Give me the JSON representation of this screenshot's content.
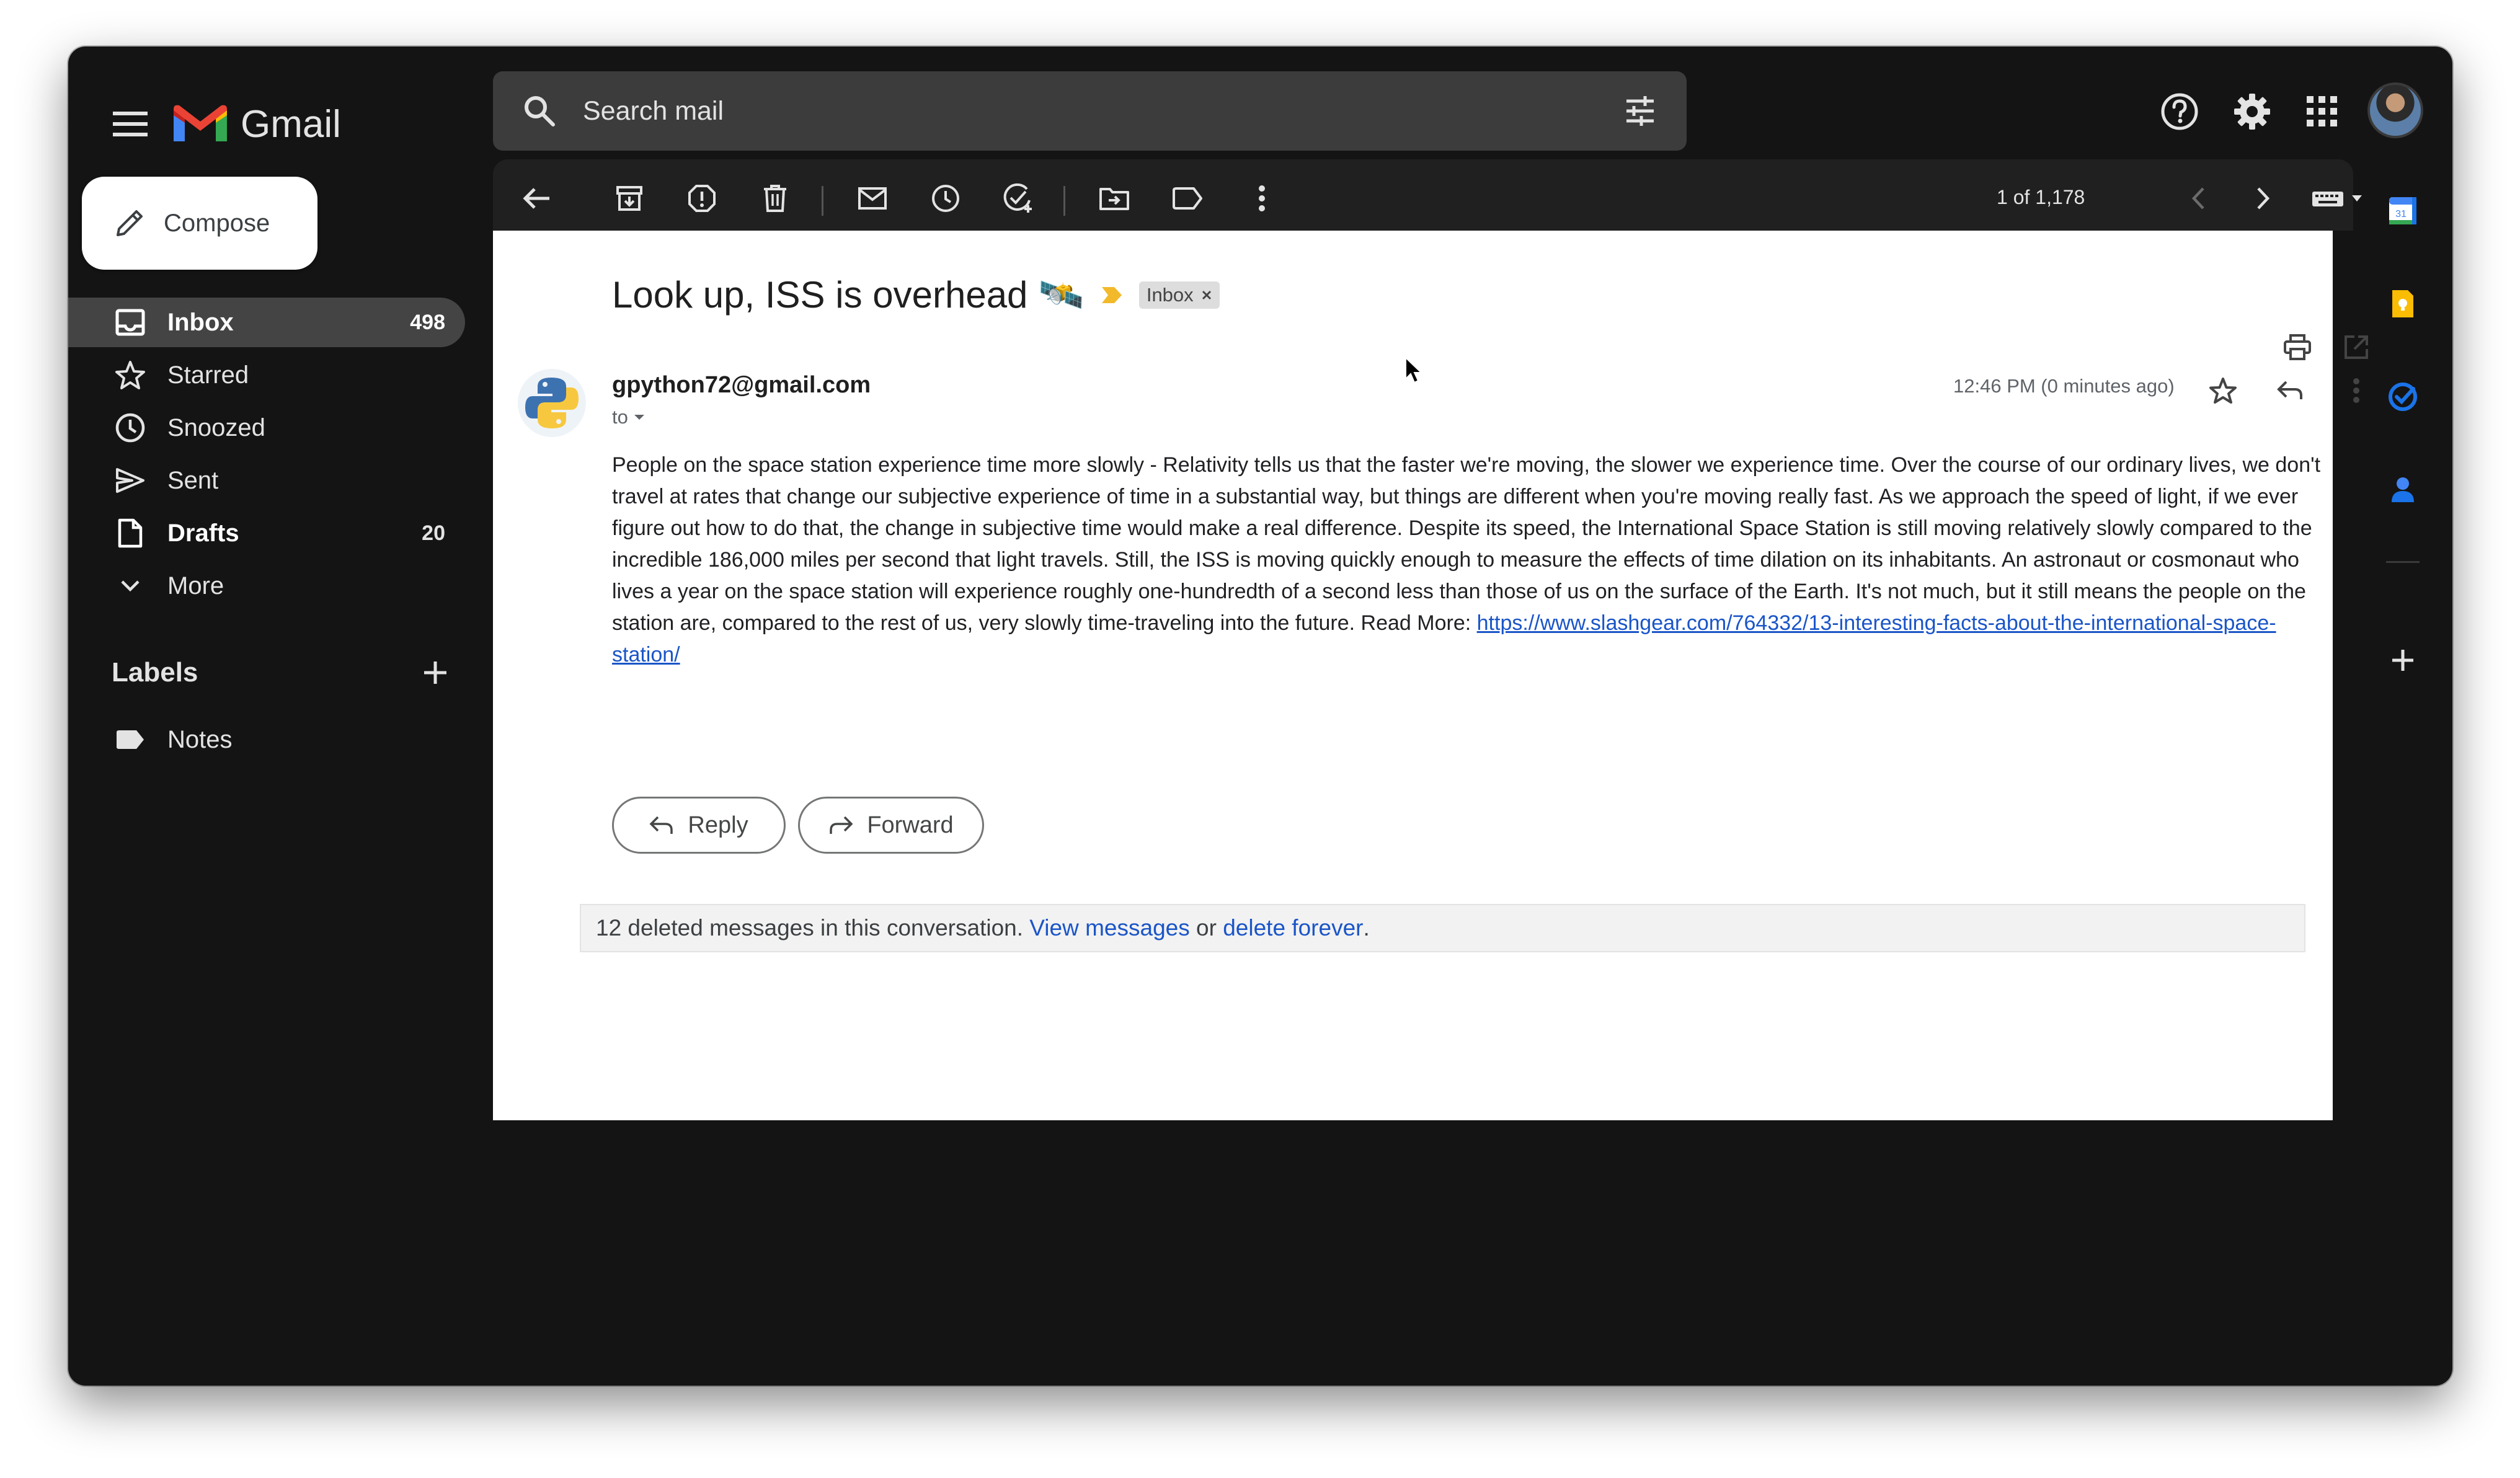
{
  "app": {
    "name": "Gmail",
    "search_placeholder": "Search mail"
  },
  "compose": {
    "label": "Compose"
  },
  "nav": {
    "items": [
      {
        "label": "Inbox",
        "count": "498",
        "icon": "inbox-icon",
        "active": true
      },
      {
        "label": "Starred",
        "count": "",
        "icon": "star-icon"
      },
      {
        "label": "Snoozed",
        "count": "",
        "icon": "clock-icon"
      },
      {
        "label": "Sent",
        "count": "",
        "icon": "send-icon"
      },
      {
        "label": "Drafts",
        "count": "20",
        "icon": "draft-icon"
      },
      {
        "label": "More",
        "count": "",
        "icon": "chevron-down-icon"
      }
    ],
    "labels_heading": "Labels",
    "labels": [
      {
        "label": "Notes",
        "icon": "label-icon"
      }
    ]
  },
  "toolbar": {
    "pager": "1 of 1,178"
  },
  "message": {
    "subject": "Look up, ISS is overhead",
    "subject_emoji": "🛰️",
    "chip": "Inbox",
    "sender": "gpython72@gmail.com",
    "to": "to",
    "time": "12:46 PM (0 minutes ago)",
    "body": "People on the space station experience time more slowly - Relativity tells us that the faster we're moving, the slower we experience time. Over the course of our ordinary lives, we don't travel at rates that change our subjective experience of time in a substantial way, but things are different when you're moving really fast. As we approach the speed of light, if we ever figure out how to do that, the change in subjective time would make a real difference. Despite its speed, the International Space Station is still moving relatively slowly compared to the incredible 186,000 miles per second that light travels. Still, the ISS is moving quickly enough to measure the effects of time dilation on its inhabitants. An astronaut or cosmonaut who lives a year on the space station will experience roughly one-hundredth of a second less than those of us on the surface of the Earth. It's not much, but it still means the people on the station are, compared to the rest of us, very slowly time-traveling into the future. Read More: ",
    "link": "https://www.slashgear.com/764332/13-interesting-facts-about-the-international-space-station/"
  },
  "actions": {
    "reply": "Reply",
    "forward": "Forward"
  },
  "deleted": {
    "text": "12 deleted messages in this conversation. ",
    "view": "View messages",
    "or": " or ",
    "delete": "delete forever",
    "end": "."
  },
  "colors": {
    "window_bg": "#141414",
    "accent_link": "#1a55c8",
    "nav_active": "#444444"
  }
}
